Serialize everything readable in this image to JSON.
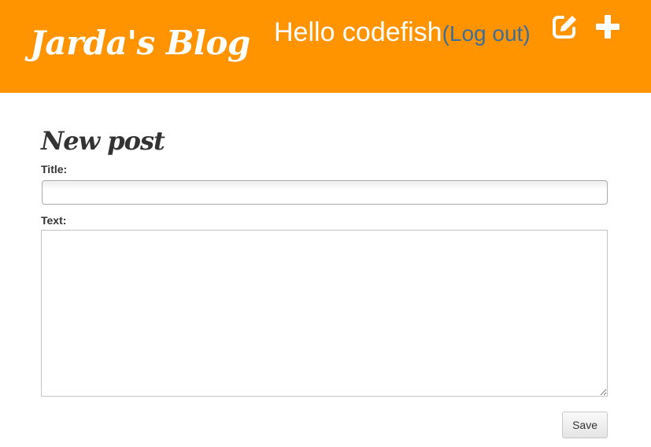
{
  "header": {
    "site_title": "Jarda's Blog",
    "greeting": "Hello codefish",
    "paren_open": "(",
    "logout_label": "Log out",
    "paren_close": ")",
    "icons": [
      "edit-icon",
      "plus-icon"
    ],
    "background_color": "#ff9400"
  },
  "main": {
    "page_title": "New post",
    "title_label": "Title:",
    "title_value": "",
    "text_label": "Text:",
    "text_value": "",
    "save_label": "Save"
  }
}
